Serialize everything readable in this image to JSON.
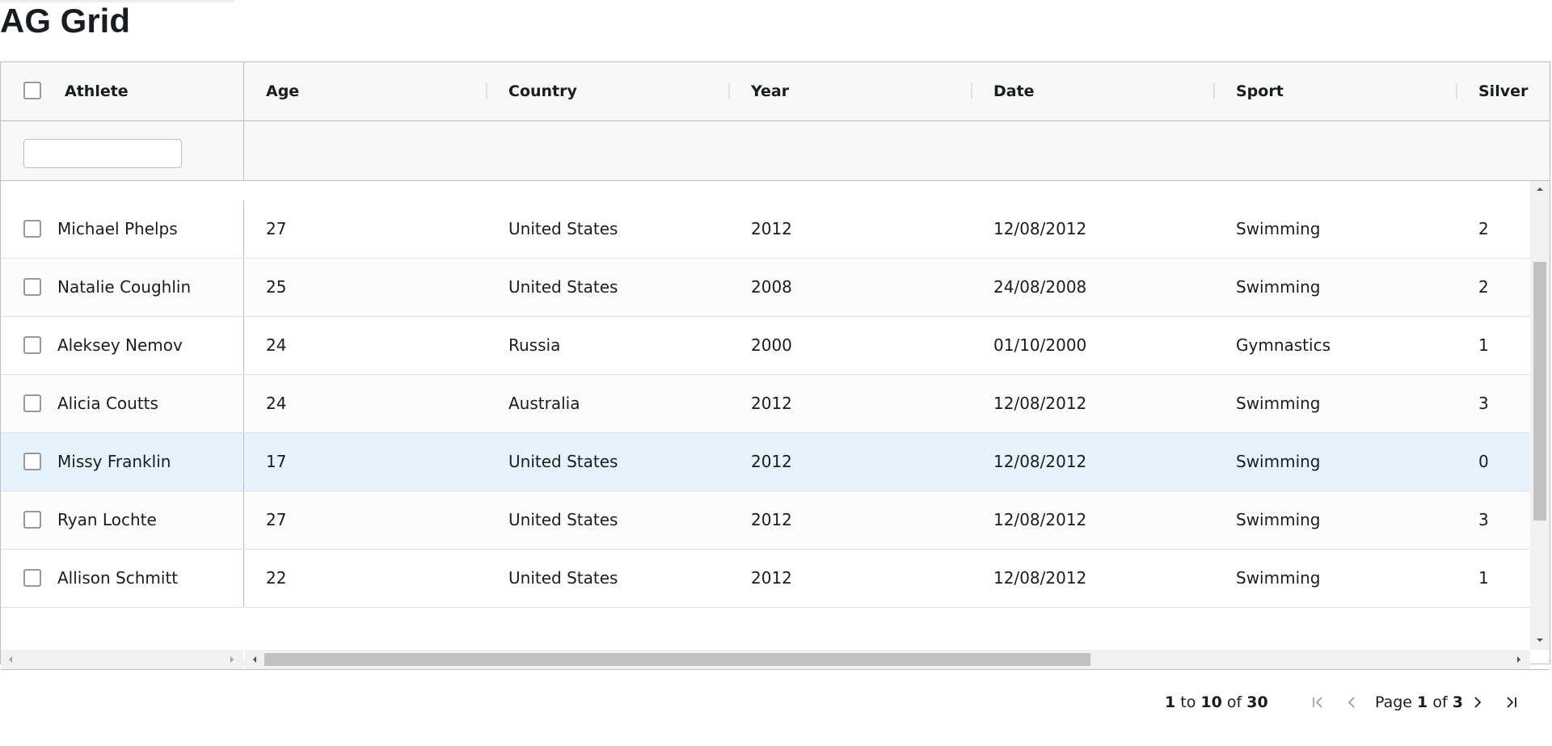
{
  "page": {
    "title": "AG Grid"
  },
  "grid": {
    "columns": [
      "Athlete",
      "Age",
      "Country",
      "Year",
      "Date",
      "Sport",
      "Silver"
    ],
    "filter": {
      "value": ""
    },
    "rows": [
      {
        "athlete": "Michael Phelps",
        "age": "27",
        "country": "United States",
        "year": "2012",
        "date": "12/08/2012",
        "sport": "Swimming",
        "silver": "2"
      },
      {
        "athlete": "Natalie Coughlin",
        "age": "25",
        "country": "United States",
        "year": "2008",
        "date": "24/08/2008",
        "sport": "Swimming",
        "silver": "2"
      },
      {
        "athlete": "Aleksey Nemov",
        "age": "24",
        "country": "Russia",
        "year": "2000",
        "date": "01/10/2000",
        "sport": "Gymnastics",
        "silver": "1"
      },
      {
        "athlete": "Alicia Coutts",
        "age": "24",
        "country": "Australia",
        "year": "2012",
        "date": "12/08/2012",
        "sport": "Swimming",
        "silver": "3"
      },
      {
        "athlete": "Missy Franklin",
        "age": "17",
        "country": "United States",
        "year": "2012",
        "date": "12/08/2012",
        "sport": "Swimming",
        "silver": "0"
      },
      {
        "athlete": "Ryan Lochte",
        "age": "27",
        "country": "United States",
        "year": "2012",
        "date": "12/08/2012",
        "sport": "Swimming",
        "silver": "3"
      },
      {
        "athlete": "Allison Schmitt",
        "age": "22",
        "country": "United States",
        "year": "2012",
        "date": "12/08/2012",
        "sport": "Swimming",
        "silver": "1"
      }
    ],
    "hovered_row": 4
  },
  "paging": {
    "from": "1",
    "to_word": "to",
    "to": "10",
    "of_word": "of",
    "total": "30",
    "page_word": "Page",
    "current": "1",
    "pages": "3"
  },
  "icons": {
    "filter": "filter-icon",
    "first": "first-page-icon",
    "previous": "previous-page-icon",
    "next": "next-page-icon",
    "last": "last-page-icon"
  },
  "colors": {
    "hover": "#e6f2fc",
    "border": "#babfc7",
    "header_bg": "#f8f8f8"
  }
}
